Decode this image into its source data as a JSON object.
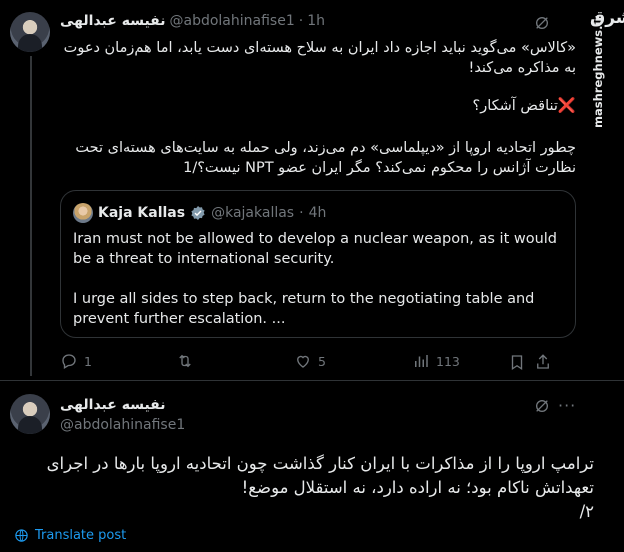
{
  "watermark": {
    "logo": "مشرق",
    "url": "mashreghnews.ir"
  },
  "tweet1": {
    "name": "نفیسه عبدالهی",
    "handle": "@abdolahinafise1",
    "sep": "·",
    "time": "1h",
    "line1": "«کالاس» می‌گوید نباید اجازه داد ایران به سلاح هسته‌ای دست یابد، اما هم‌زمان دعوت به مذاکره می‌کند!",
    "line2": "❌تناقض آشکار؟",
    "line3": "چطور اتحادیه اروپا از «دیپلماسی» دم می‌زند، ولی حمله به سایت‌های هسته‌ای تحت نظارت آژانس را محکوم نمی‌کند؟ مگر ایران عضو NPT نیست؟/1"
  },
  "quote": {
    "name": "Kaja Kallas",
    "handle": "@kajakallas",
    "sep": "·",
    "time": "4h",
    "para1": "Iran must not be allowed to develop a nuclear weapon, as it would be a threat to international security.",
    "para2": "I urge all sides to step back, return to the negotiating table and prevent further escalation. ..."
  },
  "actions": {
    "replies": "1",
    "reposts": "",
    "likes": "5",
    "views": "113"
  },
  "tweet2": {
    "name": "نفیسه عبدالهی",
    "handle": "@abdolahinafise1",
    "more": "···",
    "text": "ترامپ اروپا را از مذاکرات با ایران کنار گذاشت چون اتحادیه اروپا بارها در اجرای تعهداتش ناکام بود؛ نه اراده دارد، نه استقلال موضع!",
    "page": "۲/"
  },
  "translate": {
    "label": "Translate post"
  },
  "colors": {
    "accent": "#1d9bf0",
    "muted": "#71767b",
    "text": "#e7e9ea",
    "bg": "#000000",
    "border": "#2f3336"
  }
}
